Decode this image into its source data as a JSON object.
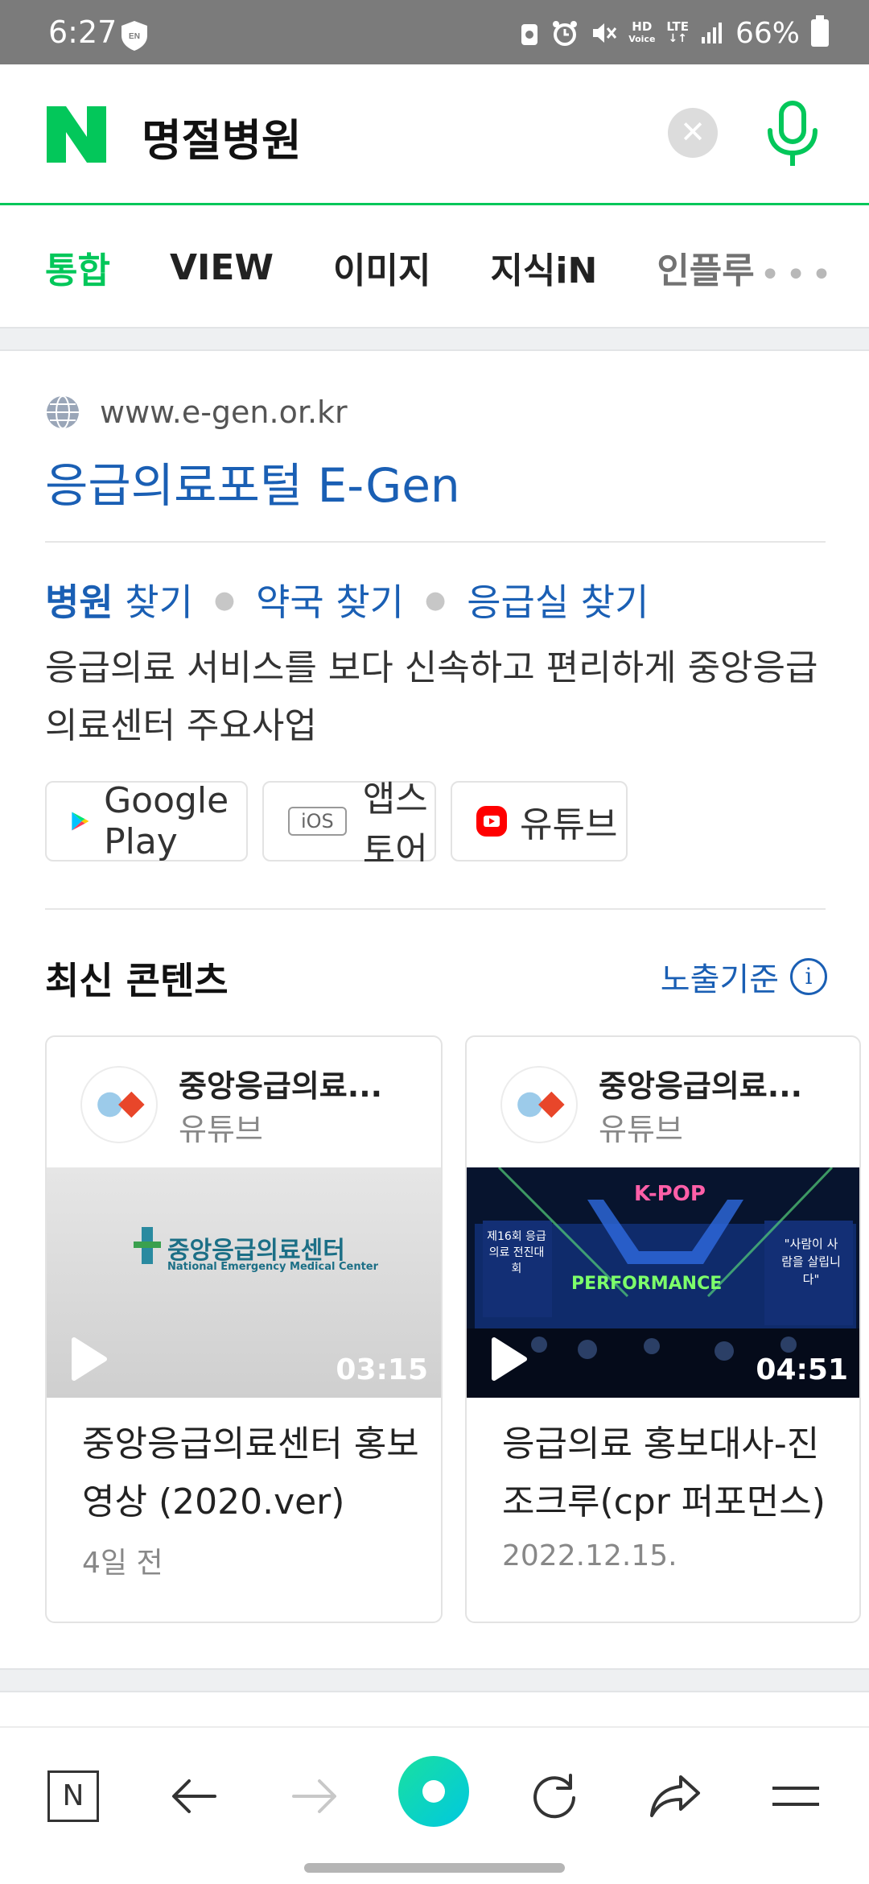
{
  "status_bar": {
    "time": "6:27",
    "battery": "66%",
    "network_badge_top": "HD",
    "network_badge_bottom": "Voice",
    "lte_label": "LTE"
  },
  "search": {
    "logo_letter": "N",
    "query": "명절병원",
    "brand_color": "#03c75a"
  },
  "tabs": [
    {
      "label": "통합",
      "active": true
    },
    {
      "label": "VIEW"
    },
    {
      "label": "이미지"
    },
    {
      "label": "지식iN"
    },
    {
      "label": "인플루"
    }
  ],
  "result": {
    "site_url": "www.e-gen.or.kr",
    "title": "응급의료포털 E-Gen",
    "sitelinks": {
      "first_bold": "병원",
      "first_rest": " 찾기",
      "second": "약국 찾기",
      "third": "응급실 찾기"
    },
    "description": "응급의료 서비스를 보다 신속하고 편리하게 중앙응급의료센터 주요사업",
    "app_links": {
      "google_play": "Google Play",
      "ios_badge": "iOS",
      "app_store": "앱스토어",
      "youtube": "유튜브"
    }
  },
  "latest": {
    "heading": "최신 콘텐츠",
    "exposure_label": "노출기준",
    "info_glyph": "i",
    "cards": [
      {
        "channel": "중앙응급의료...",
        "source": "유튜브",
        "thumb_text": "중앙응급의료센터",
        "thumb_subtext": "National Emergency Medical Center",
        "duration": "03:15",
        "title": "중앙응급의료센터 홍보 영상 (2020.ver)",
        "date": "4일 전"
      },
      {
        "channel": "중앙응급의료...",
        "source": "유튜브",
        "thumb_banner_left": "제16회 응급의료 전진대회",
        "thumb_main": "PERFORMANCE",
        "thumb_top": "K-POP",
        "thumb_right": "\"사람이 사람을 살립니다\"",
        "duration": "04:51",
        "title": "응급의료 홍보대사-진조크루(cpr 퍼포먼스)",
        "date": "2022.12.15."
      }
    ]
  },
  "bottom_nav": {
    "home_letter": "N"
  }
}
